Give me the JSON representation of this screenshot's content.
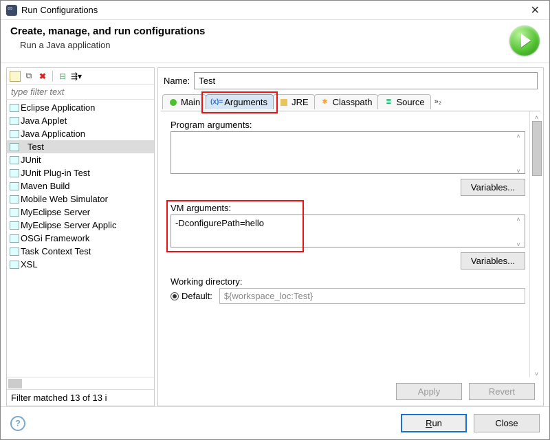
{
  "window": {
    "title": "Run Configurations"
  },
  "header": {
    "title": "Create, manage, and run configurations",
    "subtitle": "Run a Java application"
  },
  "toolbar": {
    "new": "new-config-icon",
    "duplicate": "duplicate-icon",
    "delete": "delete-icon",
    "collapse": "collapse-all-icon",
    "expand": "expand-icon"
  },
  "filter": {
    "placeholder": "type filter text"
  },
  "tree": {
    "items": [
      "Eclipse Application",
      "Java Applet",
      "Java Application",
      "Test",
      "JUnit",
      "JUnit Plug-in Test",
      "Maven Build",
      "Mobile Web Simulator",
      "MyEclipse Server",
      "MyEclipse Server Applic",
      "OSGi Framework",
      "Task Context Test",
      "XSL"
    ],
    "selected_index": 3
  },
  "filter_status": "Filter matched 13 of 13 i",
  "name": {
    "label": "Name:",
    "value": "Test"
  },
  "tabs": {
    "items": [
      "Main",
      "Arguments",
      "JRE",
      "Classpath",
      "Source"
    ],
    "active_index": 1,
    "overflow": "»₂"
  },
  "arguments": {
    "program_label": "Program arguments:",
    "program_value": "",
    "variables_label": "Variables...",
    "vm_label": "VM arguments:",
    "vm_value": "-DconfigurePath=hello",
    "working_dir_label": "Working directory:",
    "default_label": "Default:",
    "default_value": "${workspace_loc:Test}"
  },
  "buttons": {
    "apply": "Apply",
    "revert": "Revert",
    "run": "Run",
    "close": "Close"
  }
}
